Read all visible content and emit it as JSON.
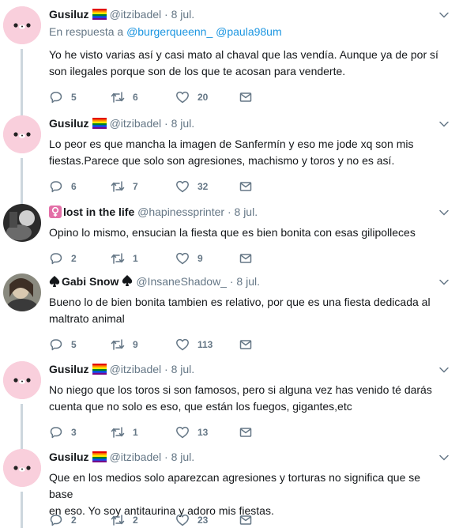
{
  "colors": {
    "accent": "#1b95e0",
    "muted": "#657786",
    "text": "#14171a",
    "line": "#ccd6dd"
  },
  "replying": {
    "prefix": "En respuesta a",
    "users": [
      "@burgerqueenn_",
      "@paula98um"
    ]
  },
  "tweets": [
    {
      "name": "Gusiluz",
      "badge_icon": "rainbow-flag-icon",
      "handle": "@itzibadel",
      "dot": "·",
      "date": "8 jul.",
      "avatar": "pink-kawaii-avatar",
      "text_lines": [
        "Yo he visto varias así y casi mato al chaval que las vendía. Aunque ya de por sí",
        "son ilegales porque son de los que te acosan para venderte."
      ],
      "replies": "5",
      "retweets": "6",
      "likes": "20"
    },
    {
      "name": "Gusiluz",
      "badge_icon": "rainbow-flag-icon",
      "handle": "@itzibadel",
      "dot": "·",
      "date": "8 jul.",
      "avatar": "pink-kawaii-avatar",
      "text_lines": [
        "Lo peor es que mancha la imagen de Sanfermín y eso me jode xq son mis",
        "fiestas.Parece que solo son agresiones, machismo y toros y no es así."
      ],
      "replies": "6",
      "retweets": "7",
      "likes": "32"
    },
    {
      "name": "lost in the life",
      "lead_icon": "female-sign-icon",
      "handle": "@hapinessprinter",
      "dot": "·",
      "date": "8 jul.",
      "avatar": "dark-photo-avatar",
      "text_lines": [
        "Opino lo mismo, ensucian la fiesta que es bien bonita con esas gilipolleces"
      ],
      "replies": "2",
      "retweets": "1",
      "likes": "9"
    },
    {
      "name": "Gabi Snow",
      "lead_icon": "spade-icon",
      "trail_icon": "spade-icon",
      "handle": "@InsaneShadow_",
      "dot": "·",
      "date": "8 jul.",
      "avatar": "gray-photo-avatar",
      "text_lines": [
        "Bueno lo de bien bonita tambien es relativo, por que es una fiesta dedicada al",
        "maltrato animal"
      ],
      "replies": "5",
      "retweets": "9",
      "likes": "113"
    },
    {
      "name": "Gusiluz",
      "badge_icon": "rainbow-flag-icon",
      "handle": "@itzibadel",
      "dot": "·",
      "date": "8 jul.",
      "avatar": "pink-kawaii-avatar",
      "text_lines": [
        "No niego que los toros si son famosos, pero si alguna vez has venido té darás",
        "cuenta que no solo es eso, que están los fuegos, gigantes,etc"
      ],
      "replies": "3",
      "retweets": "1",
      "likes": "13"
    },
    {
      "name": "Gusiluz",
      "badge_icon": "rainbow-flag-icon",
      "handle": "@itzibadel",
      "dot": "·",
      "date": "8 jul.",
      "avatar": "pink-kawaii-avatar",
      "text_lines": [
        "Que en los medios solo aparezcan agresiones y torturas no significa que se base",
        "en eso. Yo soy antitaurina y adoro mis fiestas."
      ],
      "replies": "2",
      "retweets": "2",
      "likes": "23"
    }
  ]
}
